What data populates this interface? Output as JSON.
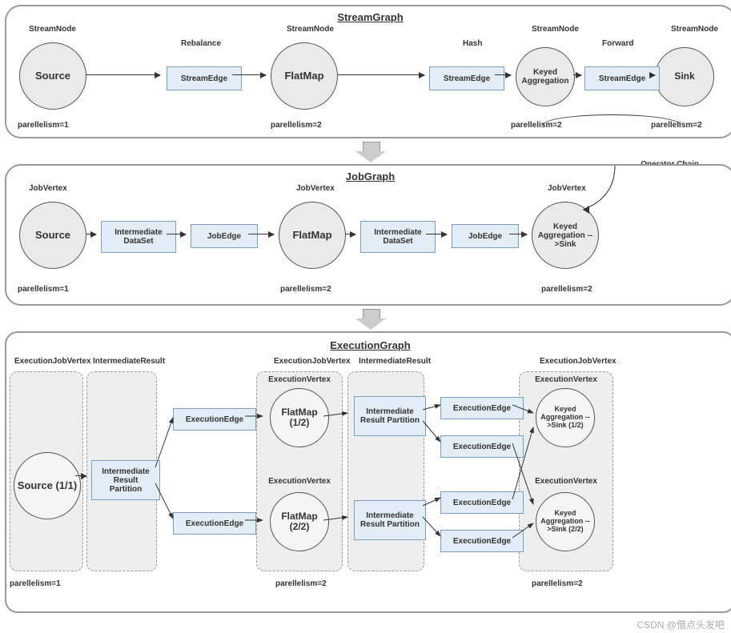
{
  "streamgraph": {
    "title": "StreamGraph",
    "nodeLabel": "StreamNode",
    "source": "Source",
    "flatmap": "FlatMap",
    "keyed": "Keyed Aggregation",
    "sink": "Sink",
    "edge": "StreamEdge",
    "rebalance": "Rebalance",
    "hash": "Hash",
    "forward": "Forward",
    "par1": "parellelism=1",
    "par2": "parellelism=2"
  },
  "opchain": "Operator Chain",
  "jobgraph": {
    "title": "JobGraph",
    "vertexLabel": "JobVertex",
    "source": "Source",
    "flatmap": "FlatMap",
    "sink": "Keyed Aggregation -->Sink",
    "ids": "Intermediate DataSet",
    "edge": "JobEdge",
    "par1": "parellelism=1",
    "par2": "parellelism=2"
  },
  "execgraph": {
    "title": "ExecutionGraph",
    "ejv": "ExecutionJobVertex",
    "ir": "IntermediateResult",
    "ev": "ExecutionVertex",
    "irp": "Intermediate Result Partition",
    "edge": "ExecutionEdge",
    "source": "Source (1/1)",
    "fm1": "FlatMap (1/2)",
    "fm2": "FlatMap (2/2)",
    "sink1": "Keyed Aggregation -->Sink (1/2)",
    "sink2": "Keyed Aggregation -->Sink (2/2)",
    "par1": "parellelism=1",
    "par2": "parellelism=2"
  },
  "watermark": "CSDN @借点头发吧"
}
